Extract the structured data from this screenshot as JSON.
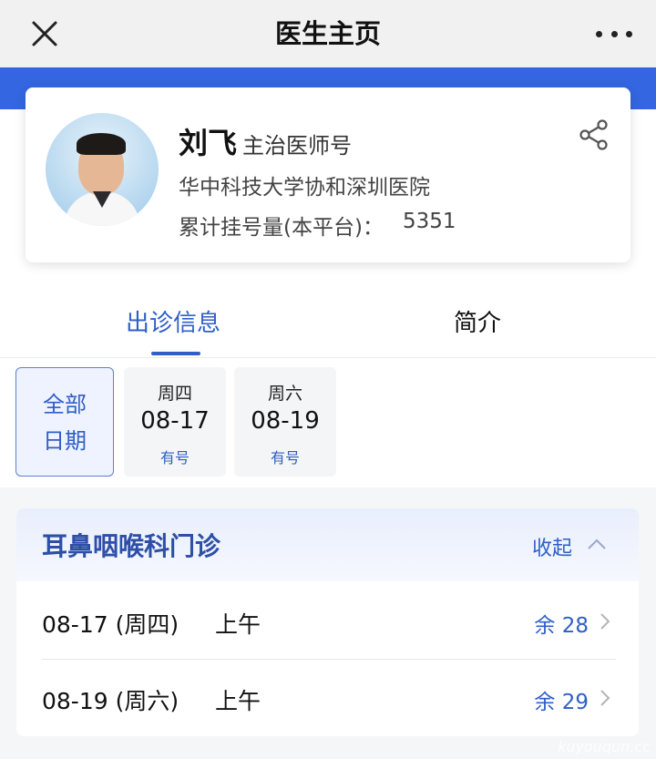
{
  "topbar": {
    "title": "医生主页",
    "close_icon": "close-icon",
    "more_icon": "more-dots-icon"
  },
  "doctor": {
    "name": "刘飞",
    "title": "主治医师号",
    "hospital": "华中科技大学协和深圳医院",
    "count_label": "累计挂号量(本平台)：",
    "count_value": "5351",
    "share_icon": "share-icon"
  },
  "tabs": [
    {
      "label": "出诊信息",
      "active": true
    },
    {
      "label": "简介",
      "active": false
    }
  ],
  "dates": {
    "all_line1": "全部",
    "all_line2": "日期",
    "chips": [
      {
        "weekday": "周四",
        "date": "08-17",
        "availability": "有号"
      },
      {
        "weekday": "周六",
        "date": "08-19",
        "availability": "有号"
      }
    ]
  },
  "department": {
    "name": "耳鼻咽喉科门诊",
    "collapse_label": "收起",
    "slots": [
      {
        "date": "08-17 (周四)",
        "period": "上午",
        "remain": "余 28"
      },
      {
        "date": "08-19 (周六)",
        "period": "上午",
        "remain": "余 29"
      }
    ]
  },
  "colors": {
    "brand_blue": "#3366e0",
    "accent_blue": "#2f5fc7"
  },
  "watermark": "kuyouqun.cc"
}
